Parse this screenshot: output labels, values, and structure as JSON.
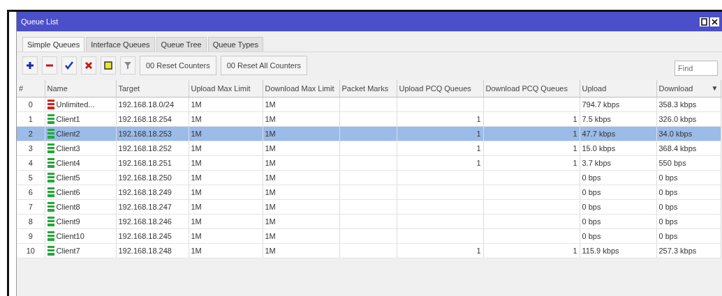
{
  "window": {
    "title": "Queue List"
  },
  "tabs": [
    {
      "label": "Simple Queues",
      "selected": true
    },
    {
      "label": "Interface Queues",
      "selected": false
    },
    {
      "label": "Queue Tree",
      "selected": false
    },
    {
      "label": "Queue Types",
      "selected": false
    }
  ],
  "toolbar": {
    "buttons": [
      {
        "kind": "add"
      },
      {
        "kind": "remove"
      },
      {
        "kind": "enable"
      },
      {
        "kind": "disable"
      },
      {
        "kind": "comment"
      },
      {
        "kind": "filter"
      }
    ],
    "text_buttons": [
      {
        "icon": "00",
        "label": "Reset Counters"
      },
      {
        "icon": "00",
        "label": "Reset All Counters"
      }
    ],
    "search": {
      "placeholder": "Find"
    }
  },
  "table": {
    "columns": [
      "#",
      "Name",
      "Target",
      "Upload Max Limit",
      "Download Max Limit",
      "Packet Marks",
      "Upload PCQ Queues",
      "Download PCQ Queues",
      "Upload",
      "Download"
    ],
    "sort_indicator": "▼",
    "rows": [
      {
        "index": "0",
        "name": "Unlimited...",
        "color": "#d42020",
        "target": "192.168.18.0/24",
        "upload_max": "1M",
        "download_max": "1M",
        "upload_pcq": "",
        "download_pcq": "",
        "upload": "794.7 kbps",
        "download": "358.3 kbps",
        "selected": false
      },
      {
        "index": "1",
        "name": "Client1",
        "color": "#22a838",
        "target": "192.168.18.254",
        "upload_max": "1M",
        "download_max": "1M",
        "upload_pcq": "1",
        "download_pcq": "1",
        "upload": "7.5 kbps",
        "download": "326.0 kbps",
        "selected": false
      },
      {
        "index": "2",
        "name": "Client2",
        "color": "#22a838",
        "target": "192.168.18.253",
        "upload_max": "1M",
        "download_max": "1M",
        "upload_pcq": "1",
        "download_pcq": "1",
        "upload": "47.7 kbps",
        "download": "34.0 kbps",
        "selected": true
      },
      {
        "index": "3",
        "name": "Client3",
        "color": "#22a838",
        "target": "192.168.18.252",
        "upload_max": "1M",
        "download_max": "1M",
        "upload_pcq": "1",
        "download_pcq": "1",
        "upload": "15.0 kbps",
        "download": "368.4 kbps",
        "selected": false
      },
      {
        "index": "4",
        "name": "Client4",
        "color": "#22a838",
        "target": "192.168.18.251",
        "upload_max": "1M",
        "download_max": "1M",
        "upload_pcq": "1",
        "download_pcq": "1",
        "upload": "3.7 kbps",
        "download": "550 bps",
        "selected": false
      },
      {
        "index": "5",
        "name": "Client5",
        "color": "#22a838",
        "target": "192.168.18.250",
        "upload_max": "1M",
        "download_max": "1M",
        "upload_pcq": "",
        "download_pcq": "",
        "upload": "0 bps",
        "download": "0 bps",
        "selected": false
      },
      {
        "index": "6",
        "name": "Client6",
        "color": "#22a838",
        "target": "192.168.18.249",
        "upload_max": "1M",
        "download_max": "1M",
        "upload_pcq": "",
        "download_pcq": "",
        "upload": "0 bps",
        "download": "0 bps",
        "selected": false
      },
      {
        "index": "7",
        "name": "Client8",
        "color": "#22a838",
        "target": "192.168.18.247",
        "upload_max": "1M",
        "download_max": "1M",
        "upload_pcq": "",
        "download_pcq": "",
        "upload": "0 bps",
        "download": "0 bps",
        "selected": false
      },
      {
        "index": "8",
        "name": "Client9",
        "color": "#22a838",
        "target": "192.168.18.246",
        "upload_max": "1M",
        "download_max": "1M",
        "upload_pcq": "",
        "download_pcq": "",
        "upload": "0 bps",
        "download": "0 bps",
        "selected": false
      },
      {
        "index": "9",
        "name": "Client10",
        "color": "#22a838",
        "target": "192.168.18.245",
        "upload_max": "1M",
        "download_max": "1M",
        "upload_pcq": "",
        "download_pcq": "",
        "upload": "0 bps",
        "download": "0 bps",
        "selected": false
      },
      {
        "index": "10",
        "name": "Client7",
        "color": "#22a838",
        "target": "192.168.18.248",
        "upload_max": "1M",
        "download_max": "1M",
        "upload_pcq": "1",
        "download_pcq": "1",
        "upload": "115.9 kbps",
        "download": "257.3 kbps",
        "selected": false
      }
    ]
  }
}
